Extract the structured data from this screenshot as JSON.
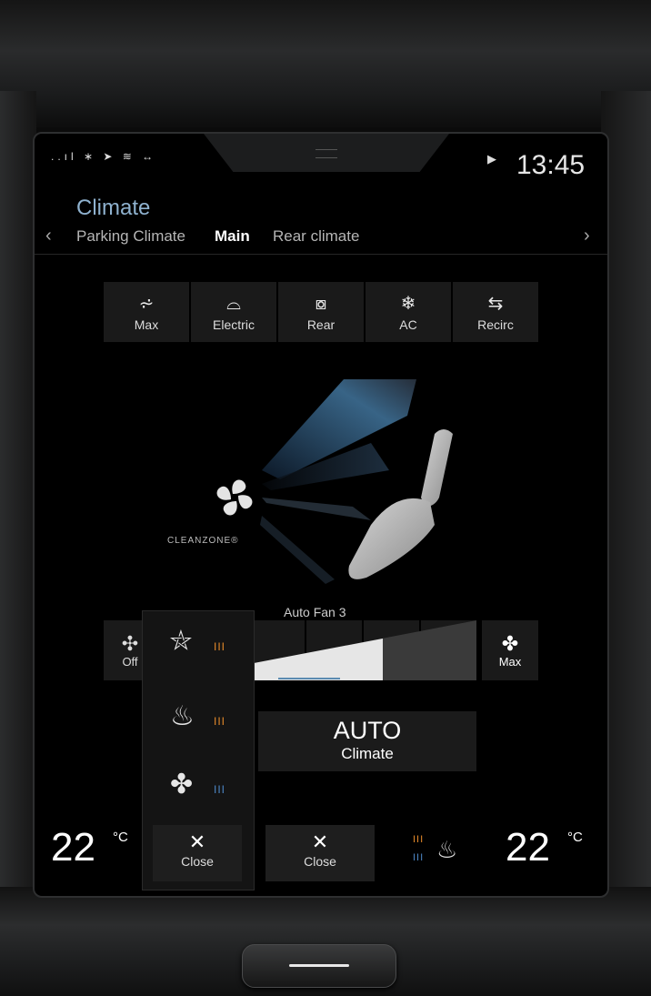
{
  "status_bar": {
    "signal_icons": "..ıl ∗ ➤ ≋ ↔",
    "media_icon": "play-icon",
    "time": "13:45"
  },
  "header": {
    "title": "Climate"
  },
  "tabs": {
    "left_chevron": "‹",
    "right_chevron": "›",
    "items": [
      {
        "label": "Parking Climate",
        "active": false
      },
      {
        "label": "Main",
        "active": true
      },
      {
        "label": "Rear climate",
        "active": false
      }
    ]
  },
  "quick_controls": [
    {
      "label": "Max",
      "icon": "front-defrost-max-icon",
      "glyph": "⩫"
    },
    {
      "label": "Electric",
      "icon": "electric-windshield-icon",
      "glyph": "⌓"
    },
    {
      "label": "Rear",
      "icon": "rear-defrost-icon",
      "glyph": "⧇"
    },
    {
      "label": "AC",
      "icon": "snowflake-icon",
      "glyph": "❄"
    },
    {
      "label": "Recirc",
      "icon": "recirculation-icon",
      "glyph": "⇆"
    }
  ],
  "cleanzone": {
    "label": "CLEANZONE®"
  },
  "fan": {
    "mode_label": "Auto Fan 3",
    "level": 3,
    "off_label": "Off",
    "max_label": "Max",
    "fan_glyph": "✤"
  },
  "auto_climate": {
    "line1": "AUTO",
    "line2": "Climate"
  },
  "seat_panel": {
    "options": [
      {
        "icon": "seat-heat-steering-icon",
        "glyph": "⛥",
        "level_glyph": "III",
        "color": "#e58a2a"
      },
      {
        "icon": "seat-heat-icon",
        "glyph": "♨",
        "level_glyph": "III",
        "color": "#e58a2a"
      },
      {
        "icon": "seat-ventilation-icon",
        "glyph": "✤",
        "level_glyph": "III",
        "color": "#4d87c7"
      }
    ]
  },
  "bottom_bar": {
    "left_temp": "22",
    "right_temp": "22",
    "unit": "°C",
    "close_left": "Close",
    "close_right": "Close",
    "close_glyph": "✕",
    "rear_seat_icon": "rear-seat-heat-vent-icon"
  },
  "colors": {
    "accent": "#8fb2cf",
    "heat": "#e58a2a",
    "cool": "#4d87c7"
  }
}
